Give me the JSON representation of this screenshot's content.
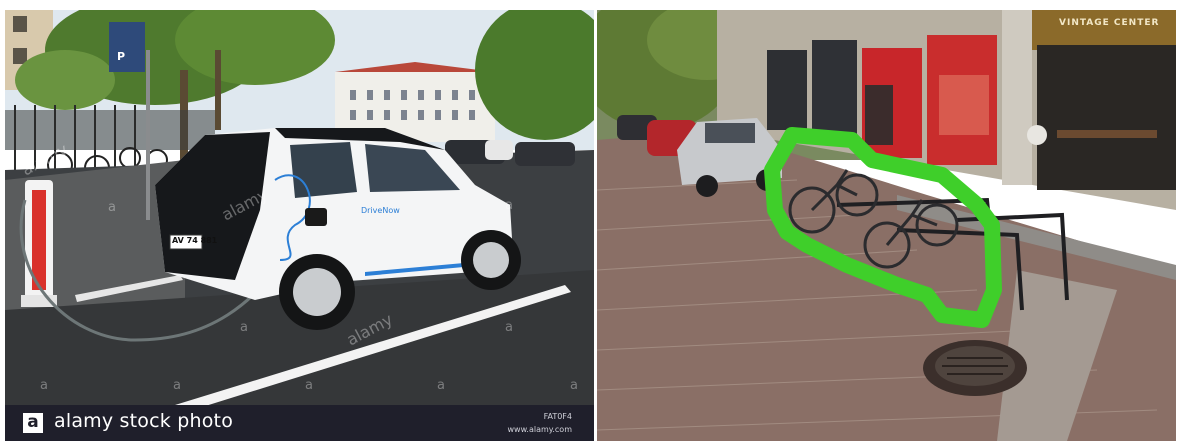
{
  "left_photo": {
    "banner": {
      "logo_letter": "a",
      "brand_text": "alamy stock photo",
      "image_id": "FAT0F4",
      "site": "www.alamy.com"
    },
    "watermark_text": "alamy",
    "watermark_letter": "a",
    "parking_sign": "P",
    "car_text": {
      "brand": "DriveNow",
      "plate": "AV 74 881"
    }
  },
  "right_photo": {
    "sign_text": "VINTAGE CENTER"
  },
  "colors": {
    "bike_rack": "#3fcf2a",
    "car": "#f2f2f2",
    "charger": "#d9312b",
    "banner": "#1f1f2b"
  }
}
